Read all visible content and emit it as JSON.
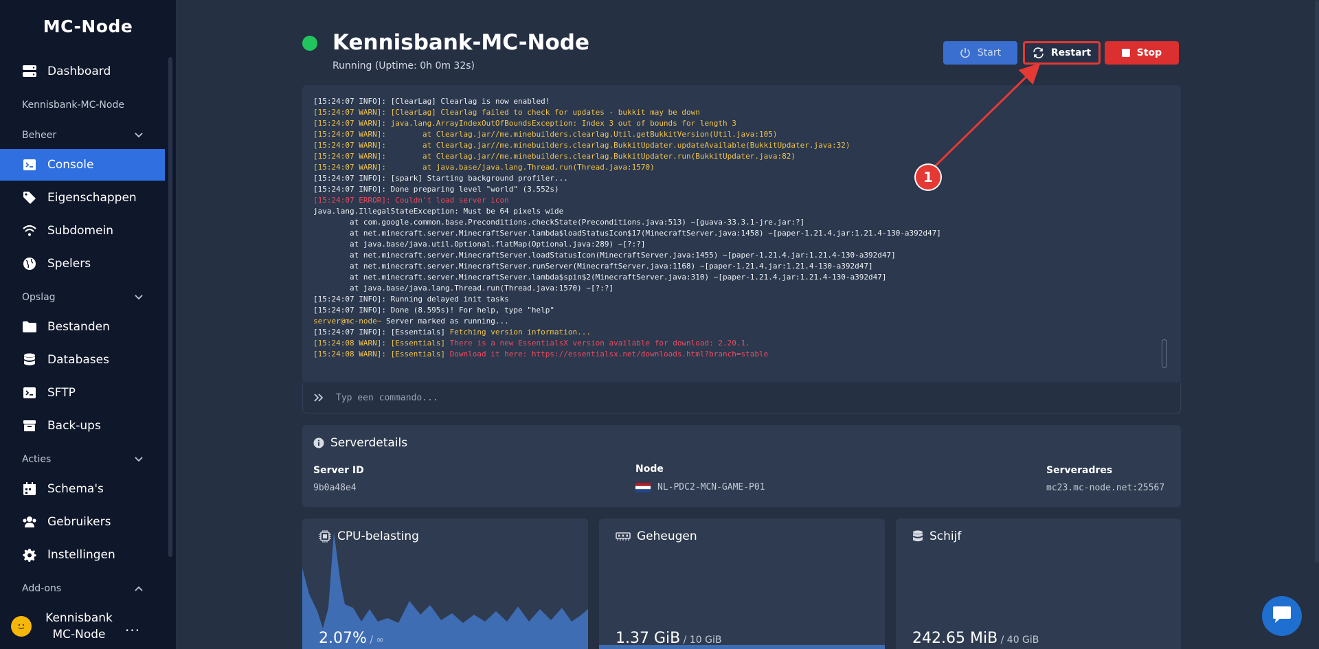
{
  "app": {
    "brand": "MC-Node"
  },
  "sidebar": {
    "dashboard": "Dashboard",
    "server_name": "Kennisbank-MC-Node",
    "sections": {
      "beheer": "Beheer",
      "opslag": "Opslag",
      "acties": "Acties",
      "addons": "Add-ons"
    },
    "items": {
      "console": "Console",
      "eigenschappen": "Eigenschappen",
      "subdomein": "Subdomein",
      "spelers": "Spelers",
      "bestanden": "Bestanden",
      "databases": "Databases",
      "sftp": "SFTP",
      "backups": "Back-ups",
      "schemas": "Schema's",
      "gebruikers": "Gebruikers",
      "instellingen": "Instellingen"
    },
    "user": {
      "name": "Kennisbank MC-Node",
      "more": "..."
    }
  },
  "header": {
    "title": "Kennisbank-MC-Node",
    "status": "Running (Uptime: 0h 0m 32s)",
    "status_color": "#20c55e",
    "buttons": {
      "start": "Start",
      "restart": "Restart",
      "stop": "Stop"
    }
  },
  "console": {
    "lines": [
      "[15:24:07 INFO]: [ClearLag] Clearlag is now enabled!",
      "[15:24:07 WARN]: [ClearLag] Clearlag failed to check for updates - bukkit may be down",
      "[15:24:07 WARN]: java.lang.ArrayIndexOutOfBoundsException: Index 3 out of bounds for length 3",
      "[15:24:07 WARN]:        at Clearlag.jar//me.minebuilders.clearlag.Util.getBukkitVersion(Util.java:105)",
      "[15:24:07 WARN]:        at Clearlag.jar//me.minebuilders.clearlag.BukkitUpdater.updateAvailable(BukkitUpdater.java:32)",
      "[15:24:07 WARN]:        at Clearlag.jar//me.minebuilders.clearlag.BukkitUpdater.run(BukkitUpdater.java:82)",
      "[15:24:07 WARN]:        at java.base/java.lang.Thread.run(Thread.java:1570)",
      "[15:24:07 INFO]: [spark] Starting background profiler...",
      "[15:24:07 INFO]: Done preparing level \"world\" (3.552s)",
      "[15:24:07 ERROR]: Couldn't load server icon",
      "java.lang.IllegalStateException: Must be 64 pixels wide",
      "        at com.google.common.base.Preconditions.checkState(Preconditions.java:513) ~[guava-33.3.1-jre.jar:?]",
      "        at net.minecraft.server.MinecraftServer.lambda$loadStatusIcon$17(MinecraftServer.java:1458) ~[paper-1.21.4.jar:1.21.4-130-a392d47]",
      "        at java.base/java.util.Optional.flatMap(Optional.java:289) ~[?:?]",
      "        at net.minecraft.server.MinecraftServer.loadStatusIcon(MinecraftServer.java:1455) ~[paper-1.21.4.jar:1.21.4-130-a392d47]",
      "        at net.minecraft.server.MinecraftServer.runServer(MinecraftServer.java:1168) ~[paper-1.21.4.jar:1.21.4-130-a392d47]",
      "        at net.minecraft.server.MinecraftServer.lambda$spin$2(MinecraftServer.java:310) ~[paper-1.21.4.jar:1.21.4-130-a392d47]",
      "        at java.base/java.lang.Thread.run(Thread.java:1570) ~[?:?]",
      "[15:24:07 INFO]: Running delayed init tasks",
      "[15:24:07 INFO]: Done (8.595s)! For help, type \"help\"",
      "server@mc-node~ Server marked as running...",
      "[15:24:07 INFO]: [Essentials] Fetching version information...",
      "[15:24:08 WARN]: [Essentials] There is a new EssentialsX version available for download: 2.20.1.",
      "[15:24:08 WARN]: [Essentials] Download it here: https://essentialsx.net/downloads.html?branch=stable"
    ],
    "command_placeholder": "Typ een commando..."
  },
  "details": {
    "title": "Serverdetails",
    "server_id_label": "Server ID",
    "server_id": "9b0a48e4",
    "node_label": "Node",
    "node": "NL-PDC2-MCN-GAME-P01",
    "address_label": "Serveradres",
    "address": "mc23.mc-node.net:25567"
  },
  "stats": {
    "cpu": {
      "title": "CPU-belasting",
      "value": "2.07%",
      "limit": " / ∞"
    },
    "memory": {
      "title": "Geheugen",
      "value": "1.37 GiB",
      "limit": " / 10 GiB",
      "fraction": 0.137
    },
    "disk": {
      "title": "Schijf",
      "value": "242.65 MiB",
      "limit": " / 40 GiB"
    }
  },
  "annotation": {
    "number": "1"
  },
  "colors": {
    "accent": "#2f6fe0",
    "stop": "#dc2f2f",
    "running": "#20c55e",
    "warn": "#f3c34d",
    "error": "#f04a60"
  }
}
